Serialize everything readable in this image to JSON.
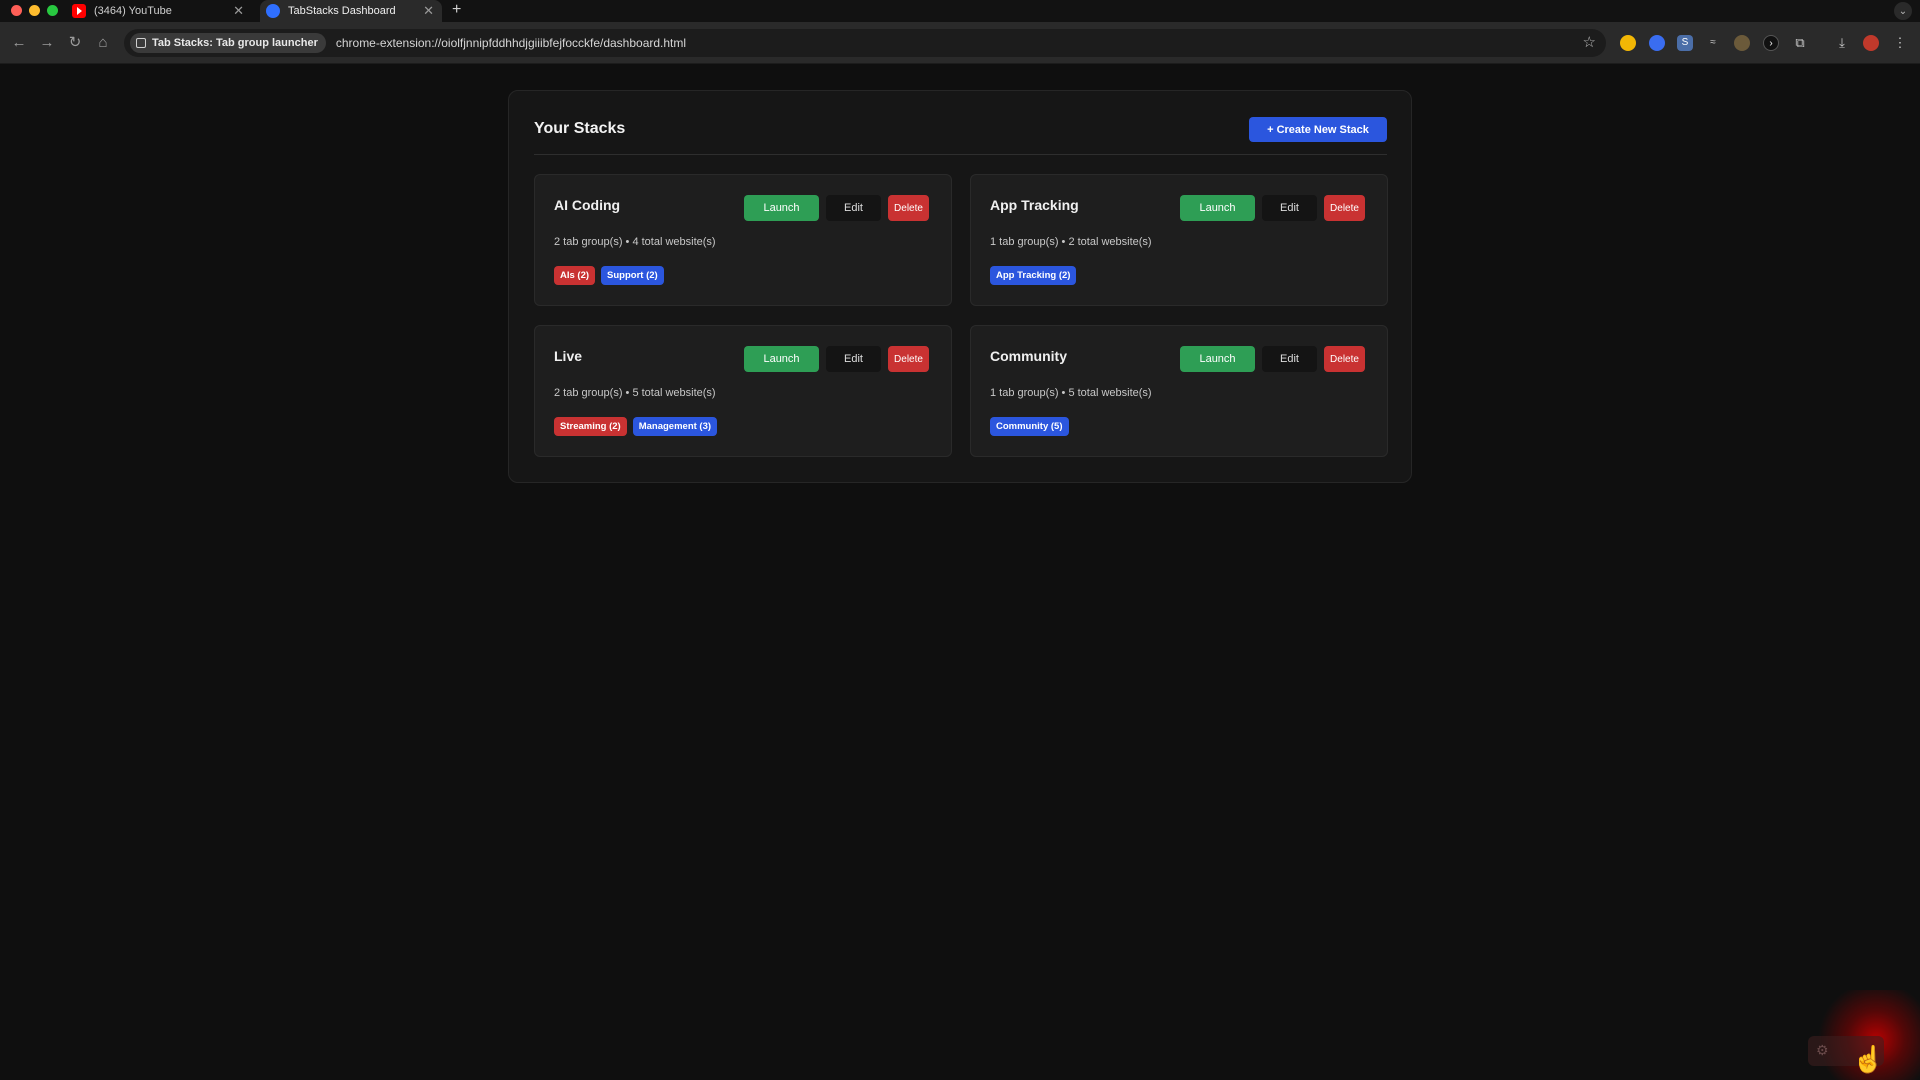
{
  "browser": {
    "tabs": [
      {
        "title": "(3464) YouTube",
        "active": false
      },
      {
        "title": "TabStacks Dashboard",
        "active": true
      }
    ],
    "site_chip": "Tab Stacks: Tab group launcher",
    "url": "chrome-extension://oiolfjnnipfddhhdjgiiibfejfocckfe/dashboard.html"
  },
  "dashboard": {
    "title": "Your Stacks",
    "create_button": "+ Create New Stack",
    "launch_label": "Launch",
    "edit_label": "Edit",
    "delete_label": "Delete",
    "stacks": [
      {
        "name": "AI Coding",
        "meta": "2 tab group(s) • 4 total website(s)",
        "tags": [
          {
            "label": "AIs (2)",
            "color": "#c93232"
          },
          {
            "label": "Support (2)",
            "color": "#2b56de"
          }
        ]
      },
      {
        "name": "App Tracking",
        "meta": "1 tab group(s) • 2 total website(s)",
        "tags": [
          {
            "label": "App Tracking (2)",
            "color": "#2b56de"
          }
        ]
      },
      {
        "name": "Live",
        "meta": "2 tab group(s) • 5 total website(s)",
        "tags": [
          {
            "label": "Streaming (2)",
            "color": "#c93232"
          },
          {
            "label": "Management (3)",
            "color": "#2b56de"
          }
        ]
      },
      {
        "name": "Community",
        "meta": "1 tab group(s) • 5 total website(s)",
        "tags": [
          {
            "label": "Community (5)",
            "color": "#2b56de"
          }
        ]
      }
    ]
  },
  "colors": {
    "launch": "#2e9e55",
    "delete": "#c93232",
    "primary": "#2b56de",
    "background": "#0f0f0f"
  }
}
